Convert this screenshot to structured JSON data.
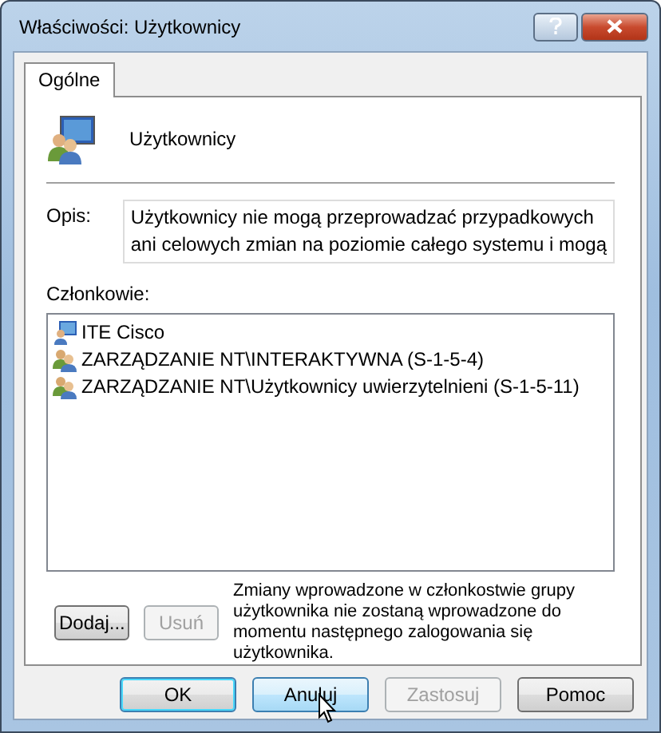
{
  "window": {
    "title": "Właściwości: Użytkownicy"
  },
  "tabs": [
    {
      "label": "Ogólne",
      "selected": true
    }
  ],
  "group": {
    "name": "Użytkownicy"
  },
  "description": {
    "label": "Opis:",
    "lines": [
      "Użytkownicy nie mogą przeprowadzać przypadkowych",
      "ani celowych zmian na poziomie całego systemu i mogą"
    ]
  },
  "members": {
    "label": "Członkowie:",
    "items": [
      {
        "name": "ITE Cisco",
        "kind": "user"
      },
      {
        "name": "ZARZĄDZANIE NT\\INTERAKTYWNA (S-1-5-4)",
        "kind": "group"
      },
      {
        "name": "ZARZĄDZANIE NT\\Użytkownicy uwierzytelnieni (S-1-5-11)",
        "kind": "group"
      }
    ]
  },
  "member_buttons": [
    {
      "label": "Dodaj...",
      "disabled": false
    },
    {
      "label": "Usuń",
      "disabled": true
    }
  ],
  "note": "Zmiany wprowadzone w członkostwie grupy użytkownika nie zostaną wprowadzone do momentu następnego zalogowania się użytkownika.",
  "buttons": [
    {
      "label": "OK",
      "default": true,
      "hovered": false,
      "disabled": false
    },
    {
      "label": "Anuluj",
      "default": false,
      "hovered": true,
      "disabled": false
    },
    {
      "label": "Zastosuj",
      "default": false,
      "hovered": false,
      "disabled": true
    },
    {
      "label": "Pomoc",
      "default": false,
      "hovered": false,
      "disabled": false
    }
  ]
}
